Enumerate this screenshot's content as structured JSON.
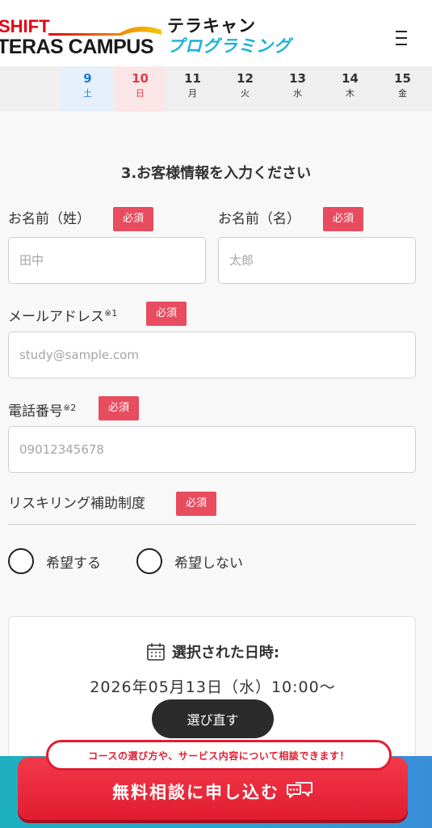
{
  "header": {
    "logo_shift": "SHIFT",
    "logo_teras": "TERAS CAMPUS",
    "logo_terakyan": "テラキャン",
    "logo_programming": "プログラミング",
    "menu_icon": "hamburger-menu-icon"
  },
  "dates": [
    {
      "num": "9",
      "dow": "土",
      "type": "sat"
    },
    {
      "num": "10",
      "dow": "日",
      "type": "sun"
    },
    {
      "num": "11",
      "dow": "月",
      "type": ""
    },
    {
      "num": "12",
      "dow": "火",
      "type": ""
    },
    {
      "num": "13",
      "dow": "水",
      "type": ""
    },
    {
      "num": "14",
      "dow": "木",
      "type": ""
    },
    {
      "num": "15",
      "dow": "金",
      "type": ""
    }
  ],
  "form": {
    "title": "3.お客様情報を入力ください",
    "required": "必須",
    "last_name_label": "お名前（姓）",
    "last_name_placeholder": "田中",
    "first_name_label": "お名前（名）",
    "first_name_placeholder": "太郎",
    "email_label": "メールアドレス",
    "email_note": "※1",
    "email_placeholder": "study@sample.com",
    "phone_label": "電話番号",
    "phone_note": "※2",
    "phone_placeholder": "09012345678",
    "reskilling_label": "リスキリング補助制度",
    "option_yes": "希望する",
    "option_no": "希望しない"
  },
  "selected": {
    "icon": "calendar-icon",
    "title": "選択された日時:",
    "datetime": "2026年05月13日（水）10:00〜",
    "redo_label": "選び直す"
  },
  "cta": {
    "bubble": "コースの選び方や、サービス内容について相談できます！",
    "button": "無料相談に申し込む",
    "icon": "chat-bubble-icon"
  },
  "colors": {
    "accent_red": "#e21c30",
    "required_badge": "#e84c5f",
    "saturday_blue": "#1a7ad8",
    "sunday_red": "#e03a48",
    "brand_cyan": "#1bb1d8"
  }
}
